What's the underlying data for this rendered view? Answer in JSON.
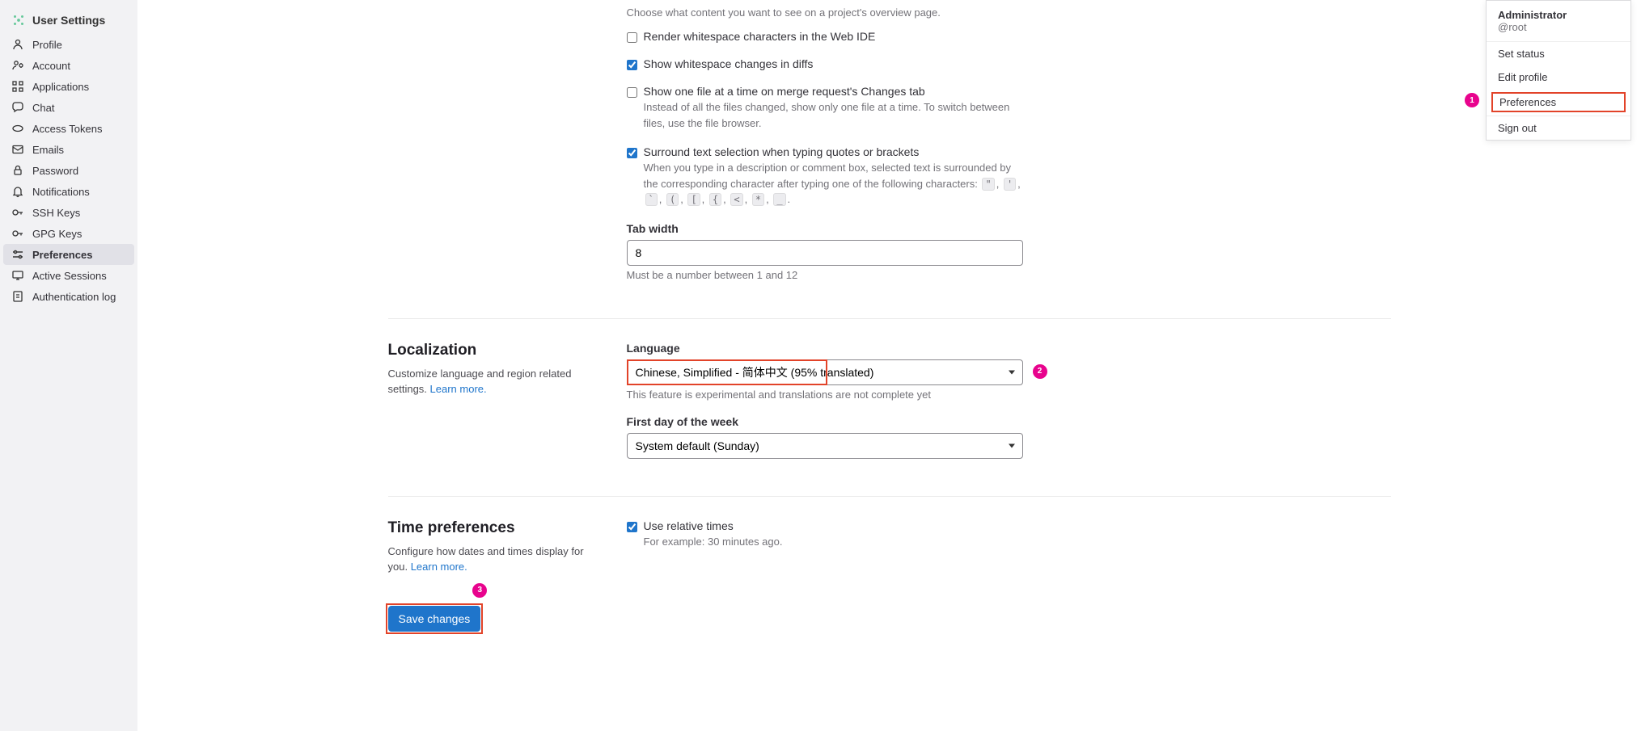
{
  "sidebar": {
    "title": "User Settings",
    "items": [
      {
        "label": "Profile",
        "icon": "profile-icon"
      },
      {
        "label": "Account",
        "icon": "account-icon"
      },
      {
        "label": "Applications",
        "icon": "applications-icon"
      },
      {
        "label": "Chat",
        "icon": "chat-icon"
      },
      {
        "label": "Access Tokens",
        "icon": "token-icon"
      },
      {
        "label": "Emails",
        "icon": "email-icon"
      },
      {
        "label": "Password",
        "icon": "password-icon"
      },
      {
        "label": "Notifications",
        "icon": "notifications-icon"
      },
      {
        "label": "SSH Keys",
        "icon": "key-icon"
      },
      {
        "label": "GPG Keys",
        "icon": "key-icon"
      },
      {
        "label": "Preferences",
        "icon": "preferences-icon",
        "active": true
      },
      {
        "label": "Active Sessions",
        "icon": "sessions-icon"
      },
      {
        "label": "Authentication log",
        "icon": "log-icon"
      }
    ]
  },
  "user_menu": {
    "name": "Administrator",
    "handle": "@root",
    "items": [
      "Set status",
      "Edit profile",
      "Preferences"
    ],
    "signout": "Sign out"
  },
  "behavior": {
    "help1": "Choose what content you want to see on a project's overview page.",
    "render_whitespace": {
      "label": "Render whitespace characters in the Web IDE",
      "checked": false
    },
    "show_whitespace": {
      "label": "Show whitespace changes in diffs",
      "checked": true
    },
    "one_file": {
      "label": "Show one file at a time on merge request's Changes tab",
      "help": "Instead of all the files changed, show only one file at a time. To switch between files, use the file browser.",
      "checked": false
    },
    "surround": {
      "label": "Surround text selection when typing quotes or brackets",
      "help_prefix": "When you type in a description or comment box, selected text is surrounded by the corresponding character after typing one of the following characters: ",
      "chars": [
        "\"",
        "'",
        "`",
        "(",
        "[",
        "{",
        "<",
        "*",
        "_"
      ],
      "checked": true
    },
    "tab_width": {
      "label": "Tab width",
      "value": "8",
      "help": "Must be a number between 1 and 12"
    }
  },
  "localization": {
    "title": "Localization",
    "desc": "Customize language and region related settings. ",
    "learn": "Learn more.",
    "language_label": "Language",
    "language_value": "Chinese, Simplified - 简体中文 (95% translated)",
    "language_help": "This feature is experimental and translations are not complete yet",
    "firstday_label": "First day of the week",
    "firstday_value": "System default (Sunday)"
  },
  "time": {
    "title": "Time preferences",
    "desc": "Configure how dates and times display for you. ",
    "learn": "Learn more.",
    "relative": {
      "label": "Use relative times",
      "help": "For example: 30 minutes ago.",
      "checked": true
    }
  },
  "save_button": "Save changes",
  "callouts": {
    "1": "1",
    "2": "2",
    "3": "3"
  }
}
